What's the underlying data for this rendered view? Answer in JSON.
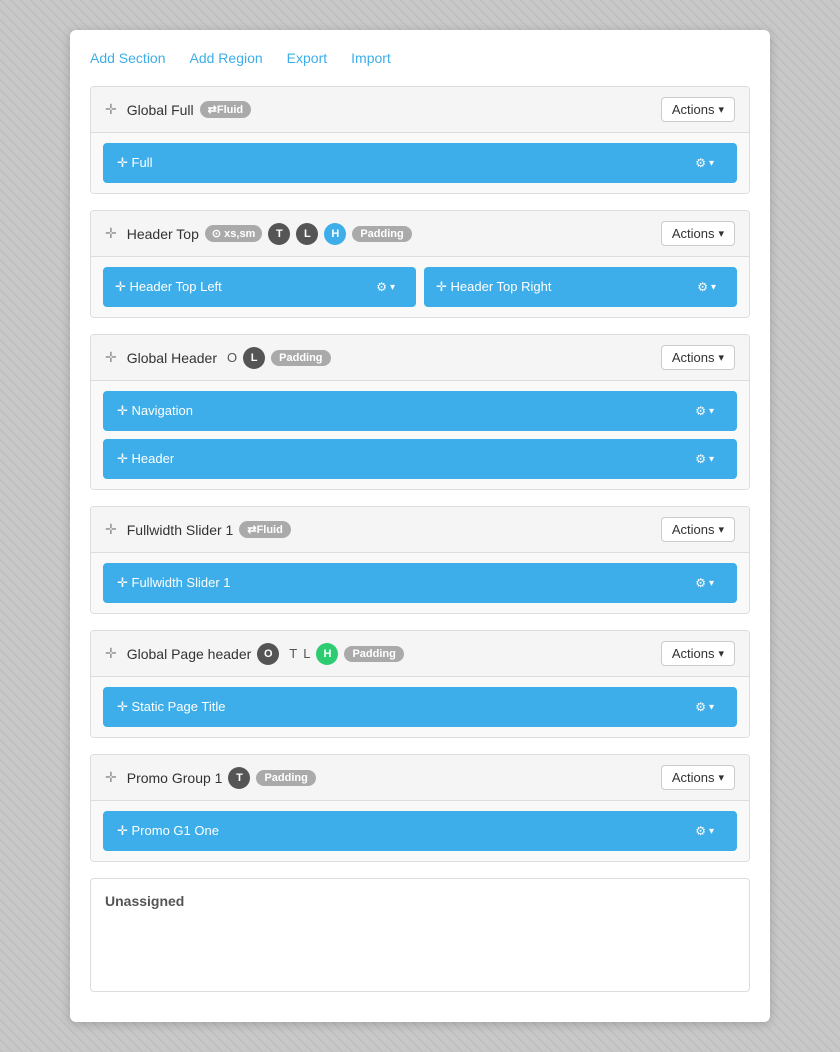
{
  "nav": {
    "add_section": "Add Section",
    "add_region": "Add Region",
    "export": "Export",
    "import": "Import"
  },
  "sections": [
    {
      "id": "global-full",
      "name": "Global Full",
      "badges": [
        "fluid"
      ],
      "actions_label": "Actions",
      "regions": [
        {
          "id": "full",
          "name": "Full",
          "type": "full"
        }
      ]
    },
    {
      "id": "header-top",
      "name": "Header Top",
      "badges": [
        "xs-sm",
        "T",
        "L",
        "H",
        "Padding"
      ],
      "actions_label": "Actions",
      "regions": [
        {
          "id": "header-top-left",
          "name": "Header Top Left",
          "type": "half"
        },
        {
          "id": "header-top-right",
          "name": "Header Top Right",
          "type": "half"
        }
      ]
    },
    {
      "id": "global-header",
      "name": "Global Header",
      "badges": [
        "O",
        "L",
        "Padding"
      ],
      "actions_label": "Actions",
      "regions": [
        {
          "id": "navigation",
          "name": "Navigation",
          "type": "full"
        },
        {
          "id": "header",
          "name": "Header",
          "type": "full"
        }
      ]
    },
    {
      "id": "fullwidth-slider-1",
      "name": "Fullwidth Slider 1",
      "badges": [
        "fluid"
      ],
      "actions_label": "Actions",
      "regions": [
        {
          "id": "fullwidth-slider-1-region",
          "name": "Fullwidth Slider 1",
          "type": "full"
        }
      ]
    },
    {
      "id": "global-page-header",
      "name": "Global Page header",
      "badges": [
        "O",
        "T",
        "L",
        "H",
        "Padding"
      ],
      "actions_label": "Actions",
      "regions": [
        {
          "id": "static-page-title",
          "name": "Static Page Title",
          "type": "full"
        }
      ]
    },
    {
      "id": "promo-group-1",
      "name": "Promo Group 1",
      "badges": [
        "T",
        "Padding"
      ],
      "actions_label": "Actions",
      "regions": [
        {
          "id": "promo-g1-one",
          "name": "Promo G1 One",
          "type": "full"
        }
      ]
    }
  ],
  "unassigned": {
    "title": "Unassigned"
  },
  "icons": {
    "drag": "✛",
    "gear": "⚙"
  }
}
